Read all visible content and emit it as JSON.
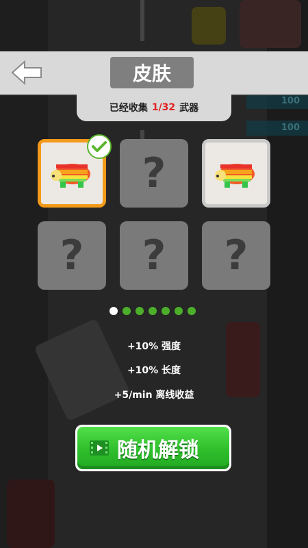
{
  "header": {
    "title": "皮肤",
    "back_icon": "back-arrow-icon"
  },
  "collection": {
    "prefix": "已经收集",
    "count": "1/32",
    "suffix": "武器"
  },
  "side_stats": [
    "100",
    "100"
  ],
  "grid": {
    "tiles": [
      {
        "state": "selected",
        "item": "rainbow-bear-icon",
        "checked": true
      },
      {
        "state": "locked",
        "glyph": "?"
      },
      {
        "state": "owned",
        "item": "rainbow-bear-icon"
      },
      {
        "state": "locked",
        "glyph": "?"
      },
      {
        "state": "locked",
        "glyph": "?"
      },
      {
        "state": "locked",
        "glyph": "?"
      }
    ]
  },
  "pagination": {
    "total": 7,
    "current": 1
  },
  "stats": {
    "line1": "+10% 强度",
    "line2": "+10% 长度",
    "line3": "+5/min 离线收益"
  },
  "unlock_button": {
    "label": "随机解锁",
    "icon": "video-film-icon"
  },
  "colors": {
    "accent_green": "#2fbf2c",
    "selected_orange": "#f39a1a",
    "count_red": "#e02020"
  }
}
